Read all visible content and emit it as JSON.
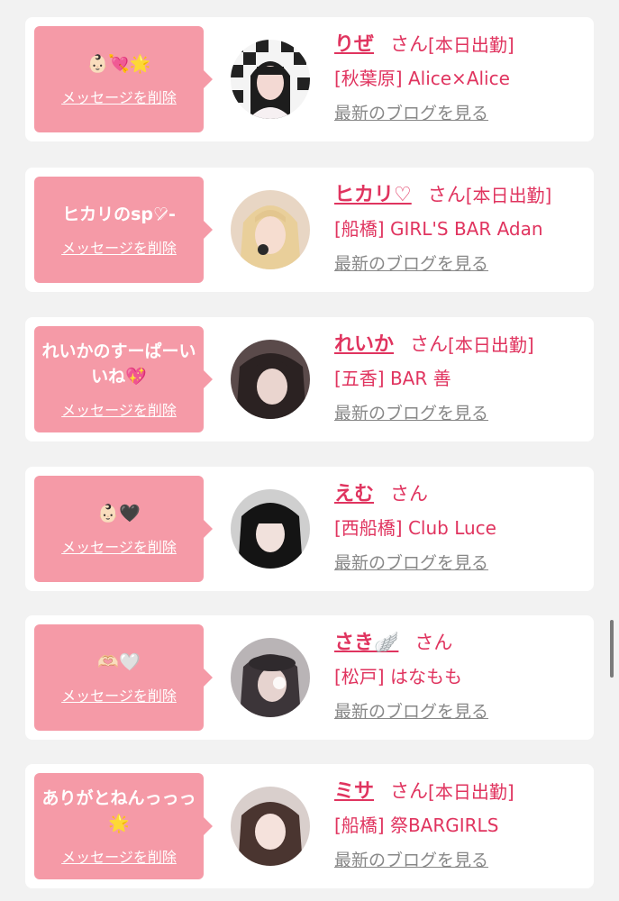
{
  "colors": {
    "bubble": "#f59aa7",
    "accent": "#e0345f",
    "blog_link": "#888888",
    "background": "#f2f2f2"
  },
  "cards": [
    {
      "message": "👶🏻💘🌟",
      "delete_label": "メッセージを削除",
      "name": "りぜ",
      "san": "さん",
      "today": "[本日出勤]",
      "shop": "[秋葉原] Alice×Alice",
      "blog": "最新のブログを見る",
      "avatar": "girl-portrait-checkered"
    },
    {
      "message": "ヒカリのsp♡̷-",
      "delete_label": "メッセージを削除",
      "name": "ヒカリ♡",
      "san": "さん",
      "today": "[本日出勤]",
      "shop": "[船橋] GIRL'S BAR Adan",
      "blog": "最新のブログを見る",
      "avatar": "girl-portrait-blonde"
    },
    {
      "message": "れいかのすーぱーいいね💖",
      "delete_label": "メッセージを削除",
      "name": "れいか",
      "san": "さん",
      "today": "[本日出勤]",
      "shop": "[五香] BAR 善",
      "blog": "最新のブログを見る",
      "avatar": "girl-portrait-dark"
    },
    {
      "message": "👶🏻🖤",
      "delete_label": "メッセージを削除",
      "name": "えむ",
      "san": "さん",
      "today": "",
      "shop": "[西船橋] Club Luce",
      "blog": "最新のブログを見る",
      "avatar": "girl-portrait-black-hair"
    },
    {
      "message": "🫶🏻🤍",
      "delete_label": "メッセージを削除",
      "name": "さき🪽",
      "san": "さん",
      "today": "",
      "shop": "[松戸] はなもも",
      "blog": "最新のブログを見る",
      "avatar": "girl-portrait-hat"
    },
    {
      "message": "ありがとねんっっっ🌟",
      "delete_label": "メッセージを削除",
      "name": "ミサ",
      "san": "さん",
      "today": "[本日出勤]",
      "shop": "[船橋] 祭BARGIRLS",
      "blog": "最新のブログを見る",
      "avatar": "girl-portrait-brown-hair"
    }
  ]
}
